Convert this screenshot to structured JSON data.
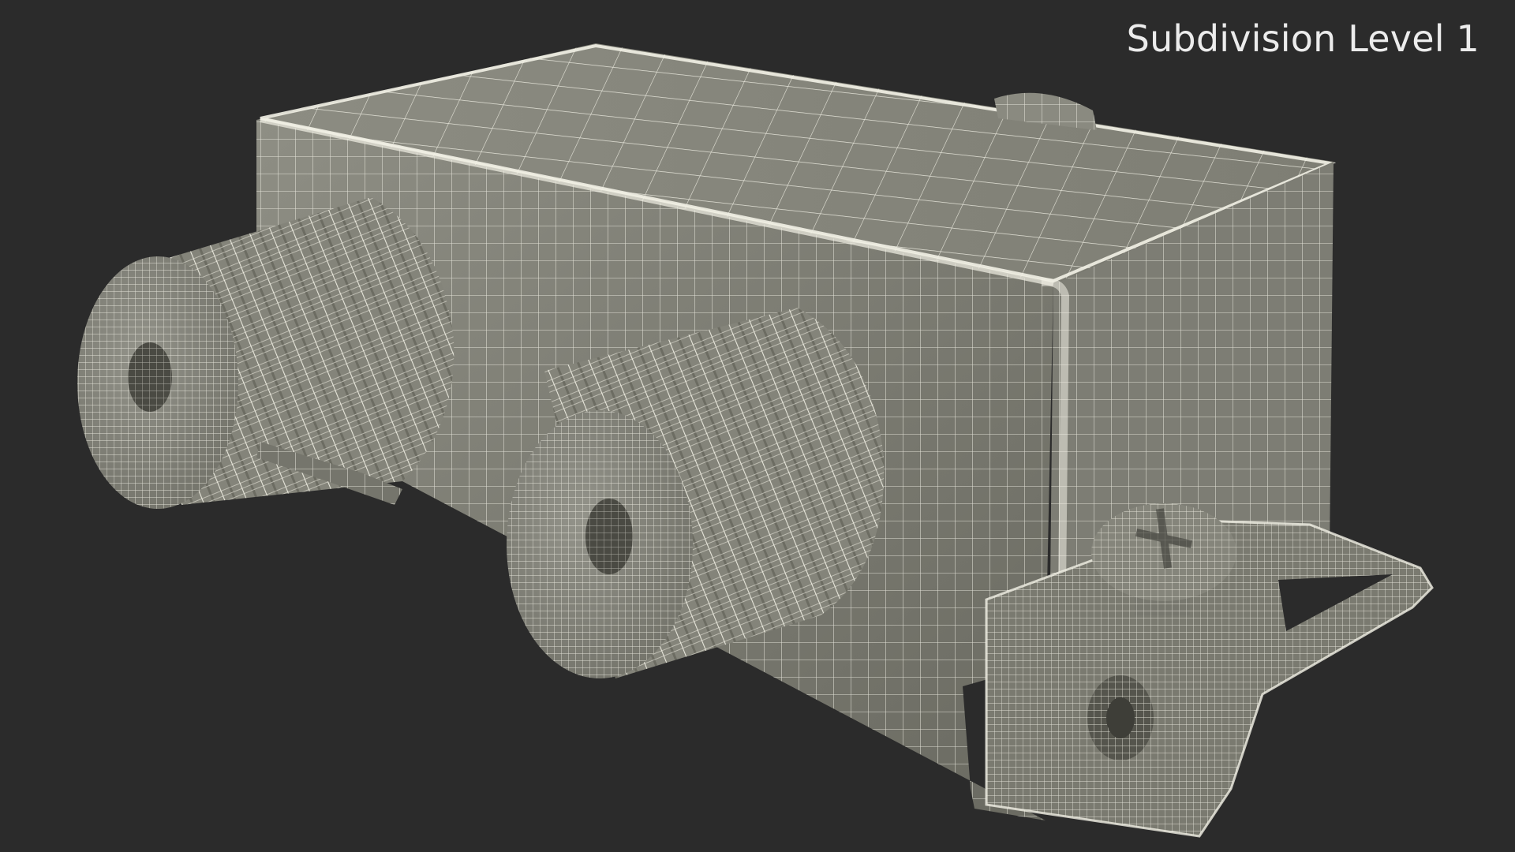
{
  "viewport": {
    "label": "Subdivision Level 1",
    "background_color": "#2b2b2b"
  },
  "model": {
    "subject": "coaxial splitter with two F-connectors, mounting bracket and screw",
    "display_mode": "wireframe",
    "surface_color": "#8a8a7c",
    "wire_color": "#f2f1e6"
  }
}
